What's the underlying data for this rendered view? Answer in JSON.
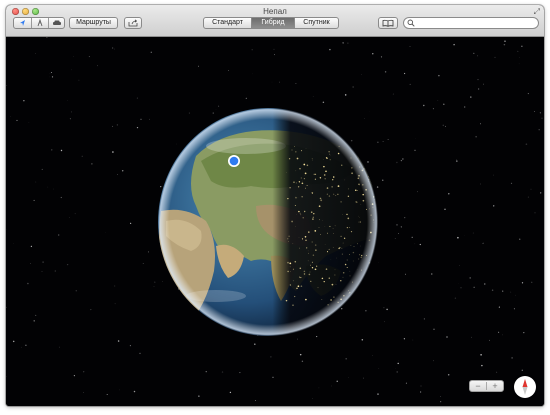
{
  "window": {
    "title": "Непал"
  },
  "toolbar": {
    "location_icon": "location-arrow-icon",
    "walk_icon": "pedestrian-icon",
    "car_icon": "car-icon",
    "routes_label": "Маршруты",
    "share_icon": "share-icon",
    "map_modes": [
      {
        "label": "Стандарт",
        "active": false
      },
      {
        "label": "Гибрид",
        "active": true
      },
      {
        "label": "Спутник",
        "active": false
      }
    ],
    "bookmarks_icon": "bookmarks-book-icon",
    "search": {
      "placeholder": "",
      "value": ""
    }
  },
  "map": {
    "zoom_out_label": "−",
    "zoom_in_label": "+",
    "compass_icon": "compass-icon"
  },
  "colors": {
    "accent_blue": "#2f7bf0",
    "night": "#020204"
  }
}
